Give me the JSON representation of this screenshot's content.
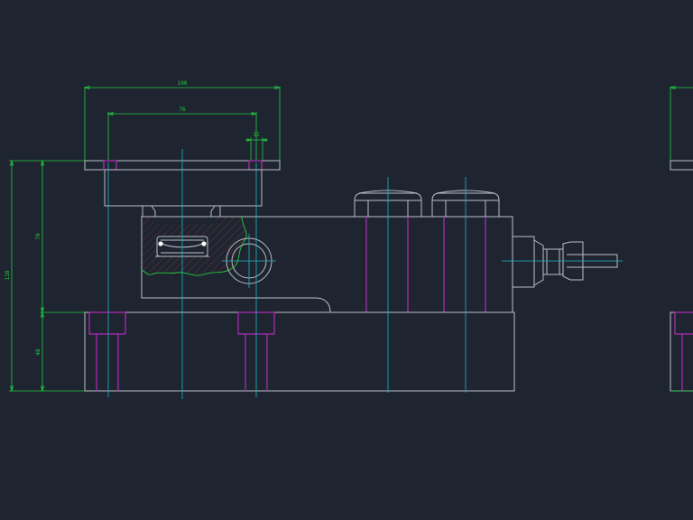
{
  "drawing": {
    "background": "#1e2530",
    "colors": {
      "geometry": "#b9bec6",
      "dimension": "#22c940",
      "centerline": "#1fb7c4",
      "hidden": "#b22ab9",
      "hatch": "#8e2f3c"
    },
    "dimensions": {
      "top_overall": "100",
      "top_hole_spacing": "76",
      "top_hole_dia": "11",
      "height_total": "118",
      "height_upper": "70",
      "height_lower": "48"
    }
  }
}
